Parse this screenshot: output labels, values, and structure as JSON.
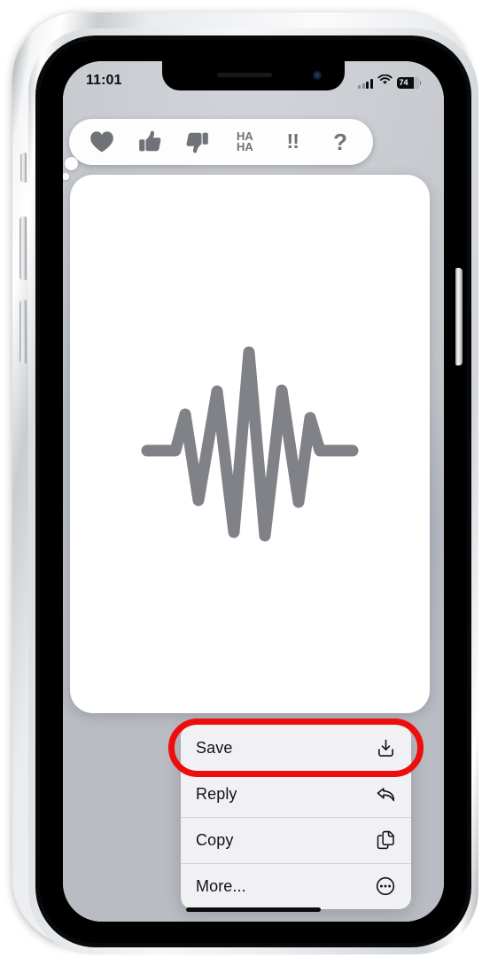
{
  "device": {
    "name": "iphone",
    "home_indicator": "home-indicator"
  },
  "status_bar": {
    "time": "11:01",
    "cellular_icon": "cellular-bars-icon",
    "cellular_bars_filled": 2,
    "cellular_bars_total": 4,
    "wifi_icon": "wifi-icon",
    "battery_icon": "battery-icon",
    "battery_percent": "74"
  },
  "reaction_bar": {
    "name": "tapback-reaction-bar",
    "items": [
      {
        "id": "heart",
        "icon": "heart-icon",
        "label": ""
      },
      {
        "id": "thumbsup",
        "icon": "thumbs-up-icon",
        "label": ""
      },
      {
        "id": "thumbsdown",
        "icon": "thumbs-down-icon",
        "label": ""
      },
      {
        "id": "haha",
        "icon": "haha-text-icon",
        "label_line1": "HA",
        "label_line2": "HA"
      },
      {
        "id": "exclaim",
        "icon": "double-exclamation-icon",
        "label": "!!"
      },
      {
        "id": "question",
        "icon": "question-mark-icon",
        "label": "?"
      }
    ]
  },
  "message": {
    "name": "audio-message-bubble",
    "content_icon": "audio-waveform-icon",
    "content_color": "#808287"
  },
  "context_menu": {
    "name": "message-context-menu",
    "items": [
      {
        "label": "Save",
        "icon": "save-download-icon",
        "highlighted": true
      },
      {
        "label": "Reply",
        "icon": "reply-arrow-icon",
        "highlighted": false
      },
      {
        "label": "Copy",
        "icon": "copy-documents-icon",
        "highlighted": false
      },
      {
        "label": "More...",
        "icon": "more-ellipsis-icon",
        "highlighted": false
      }
    ]
  },
  "annotation": {
    "name": "save-highlight-oval",
    "color": "#ee0d0d",
    "target": "Save"
  }
}
